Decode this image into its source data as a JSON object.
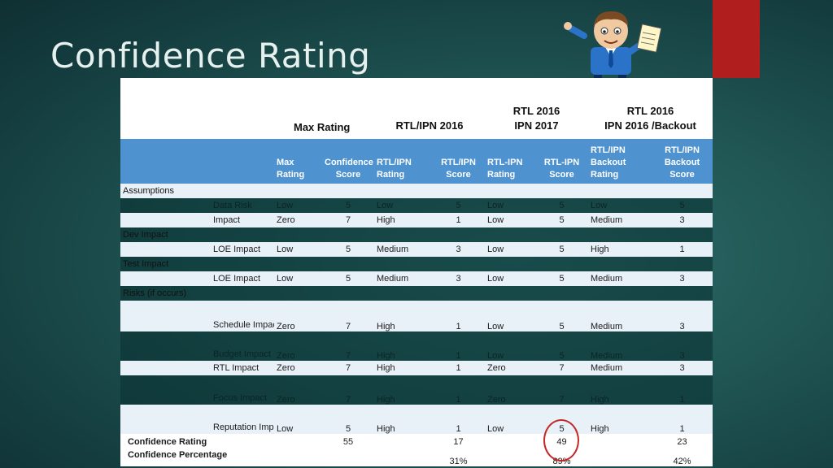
{
  "title": "Confidence Rating",
  "groups": {
    "max_rating": "Max Rating",
    "rtl_ipn_2016": "RTL/IPN 2016",
    "rtl2016_ipn2017_l1": "RTL 2016",
    "rtl2016_ipn2017_l2": "IPN 2017",
    "backout_l1": "RTL 2016",
    "backout_l2": "IPN 2016 /Backout"
  },
  "columns": {
    "max_rating": "Max Rating",
    "confidence_score": "Confidence Score",
    "rtl_ipn_rating": "RTL/IPN Rating",
    "rtl_ipn_score": "RTL/IPN Score",
    "rtl_ipn_rating2": "RTL-IPN Rating",
    "rtl_ipn_score2": "RTL-IPN Score",
    "backout_rating": "RTL/IPN Backout Rating",
    "backout_score": "RTL/IPN Backout Score"
  },
  "sections": {
    "assumptions": "Assumptions",
    "dev_impact": "Dev Impact",
    "test_impact": "Test Impact",
    "risks": "Risks (if occurs)"
  },
  "rows": {
    "data_risk": {
      "name": "Data Risk",
      "mr": "Low",
      "cs": "5",
      "r1": "Low",
      "s1": "5",
      "r2": "Low",
      "s2": "5",
      "r3": "Low",
      "s3": "5"
    },
    "impact": {
      "name": "Impact",
      "mr": "Zero",
      "cs": "7",
      "r1": "High",
      "s1": "1",
      "r2": "Low",
      "s2": "5",
      "r3": "Medium",
      "s3": "3"
    },
    "dev_loe": {
      "name": "LOE Impact",
      "mr": "Low",
      "cs": "5",
      "r1": "Medium",
      "s1": "3",
      "r2": "Low",
      "s2": "5",
      "r3": "High",
      "s3": "1"
    },
    "test_loe": {
      "name": "LOE Impact",
      "mr": "Low",
      "cs": "5",
      "r1": "Medium",
      "s1": "3",
      "r2": "Low",
      "s2": "5",
      "r3": "Medium",
      "s3": "3"
    },
    "schedule": {
      "name": "Schedule Impact",
      "mr": "Zero",
      "cs": "7",
      "r1": "High",
      "s1": "1",
      "r2": "Low",
      "s2": "5",
      "r3": "Medium",
      "s3": "3"
    },
    "budget": {
      "name": "Budget Impact",
      "mr": "Zero",
      "cs": "7",
      "r1": "High",
      "s1": "1",
      "r2": "Low",
      "s2": "5",
      "r3": "Medium",
      "s3": "3"
    },
    "rtl": {
      "name": "RTL Impact",
      "mr": "Zero",
      "cs": "7",
      "r1": "High",
      "s1": "1",
      "r2": "Zero",
      "s2": "7",
      "r3": "Medium",
      "s3": "3"
    },
    "focus": {
      "name": "Focus Impact",
      "mr": "Zero",
      "cs": "7",
      "r1": "High",
      "s1": "1",
      "r2": "Zero",
      "s2": "7",
      "r3": "High",
      "s3": "1"
    },
    "reputation": {
      "name": "Reputation Impact",
      "mr": "Low",
      "cs": "5",
      "r1": "High",
      "s1": "1",
      "r2": "Low",
      "s2": "5",
      "r3": "High",
      "s3": "1"
    }
  },
  "totals": {
    "rating_label": "Confidence Rating",
    "rating": {
      "cs": "55",
      "s1": "17",
      "s2": "49",
      "s3": "23"
    },
    "pct_label": "Confidence Percentage",
    "pct": {
      "s1": "31%",
      "s2": "89%",
      "s3": "42%"
    }
  },
  "colors": {
    "header_blue": "#4e93d0",
    "accent_red": "#b01e1e",
    "circle_red": "#c62828"
  }
}
